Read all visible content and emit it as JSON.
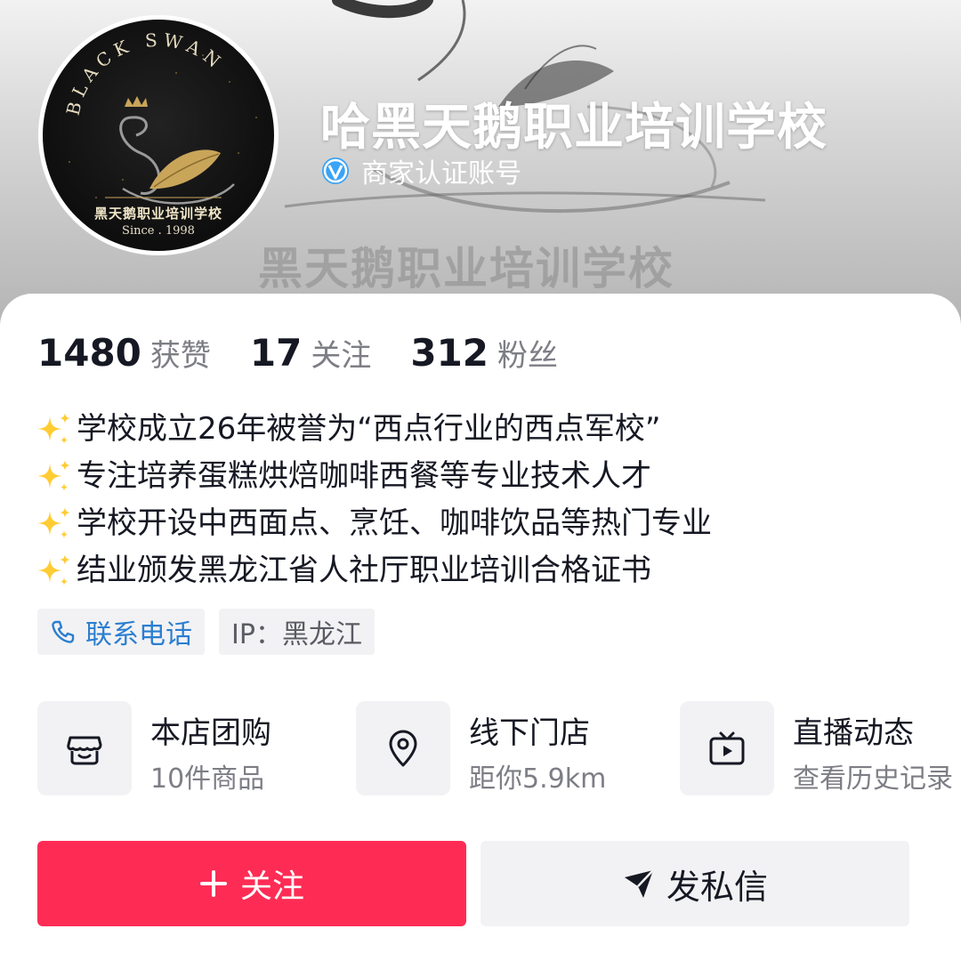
{
  "header": {
    "shop_name": "哈黑天鹅职业培训学校",
    "verified_label": "商家认证账号",
    "banner_watermark": "黑天鹅职业培训学校",
    "avatar": {
      "top_text": "BLACK SWAN",
      "school_name": "黑天鹅职业培训学校",
      "since": "Since . 1998"
    }
  },
  "stats": [
    {
      "value": "1480",
      "label": "获赞"
    },
    {
      "value": "17",
      "label": "关注"
    },
    {
      "value": "312",
      "label": "粉丝"
    }
  ],
  "bio": {
    "icon": "sparkles-icon",
    "lines": [
      "学校成立26年被誉为“西点行业的西点军校”",
      "专注培养蛋糕烘焙咖啡西餐等专业技术人才",
      "学校开设中西面点、烹饪、咖啡饮品等热门专业",
      "结业颁发黑龙江省人社厅职业培训合格证书"
    ]
  },
  "tags": {
    "phone_label": "联系电话",
    "ip_label": "IP：黑龙江"
  },
  "services": [
    {
      "icon": "shop-icon",
      "title": "本店团购",
      "subtitle": "10件商品"
    },
    {
      "icon": "location-pin-icon",
      "title": "线下门店",
      "subtitle": "距你5.9km"
    },
    {
      "icon": "tv-play-icon",
      "title": "直播动态",
      "subtitle": "查看历史记录"
    }
  ],
  "actions": {
    "follow_label": "关注",
    "message_label": "发私信"
  },
  "colors": {
    "follow_button": "#fe2c55",
    "link_blue": "#2a7ed0",
    "primary_text": "#161823",
    "secondary_text": "#7d7e85",
    "chip_bg": "#f2f2f4"
  }
}
